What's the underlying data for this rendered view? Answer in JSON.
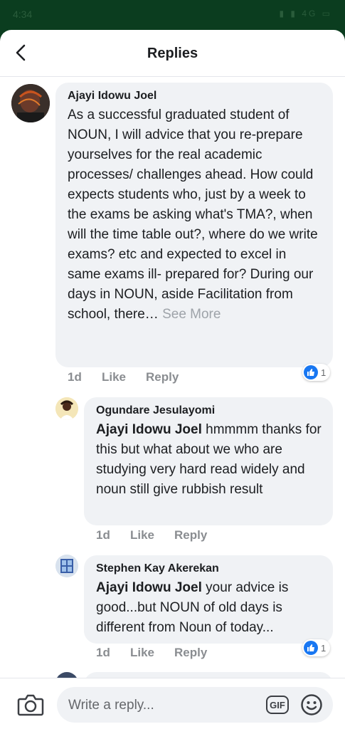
{
  "status_bar": {
    "time": "4:34",
    "indicators": "▮ ▮ 4G ▭"
  },
  "header": {
    "title": "Replies"
  },
  "comments": [
    {
      "author": "Ajayi Idowu Joel",
      "text": "As a successful graduated student of NOUN, I will advice that you re-prepare yourselves for the real academic processes/ challenges ahead. How could expects students who, just by a week to the exams be asking what's TMA?, when will the time table out?, where do we write exams? etc and expected to excel in same exams ill- prepared for? During our days in NOUN, aside Facilitation from school, there…",
      "see_more": "See More",
      "time": "1d",
      "like": "Like",
      "reply": "Reply",
      "reaction_count": "1"
    },
    {
      "author": "Ogundare Jesulayomi",
      "mention": "Ajayi Idowu Joel",
      "text": "hmmmm thanks for this but what about we who are studying very hard read widely and noun still give rubbish result",
      "time": "1d",
      "like": "Like",
      "reply": "Reply"
    },
    {
      "author": "Stephen Kay Akerekan",
      "mention": "Ajayi Idowu Joel",
      "text": "your advice is good...but NOUN of old days is different from Noun of today...",
      "time": "1d",
      "like": "Like",
      "reply": "Reply",
      "reaction_count": "1"
    }
  ],
  "composer": {
    "placeholder": "Write a reply...",
    "gif_label": "GIF"
  },
  "colors": {
    "like_blue": "#1877f2",
    "bubble": "#f0f2f5",
    "status_bg": "#0b3d1f"
  }
}
